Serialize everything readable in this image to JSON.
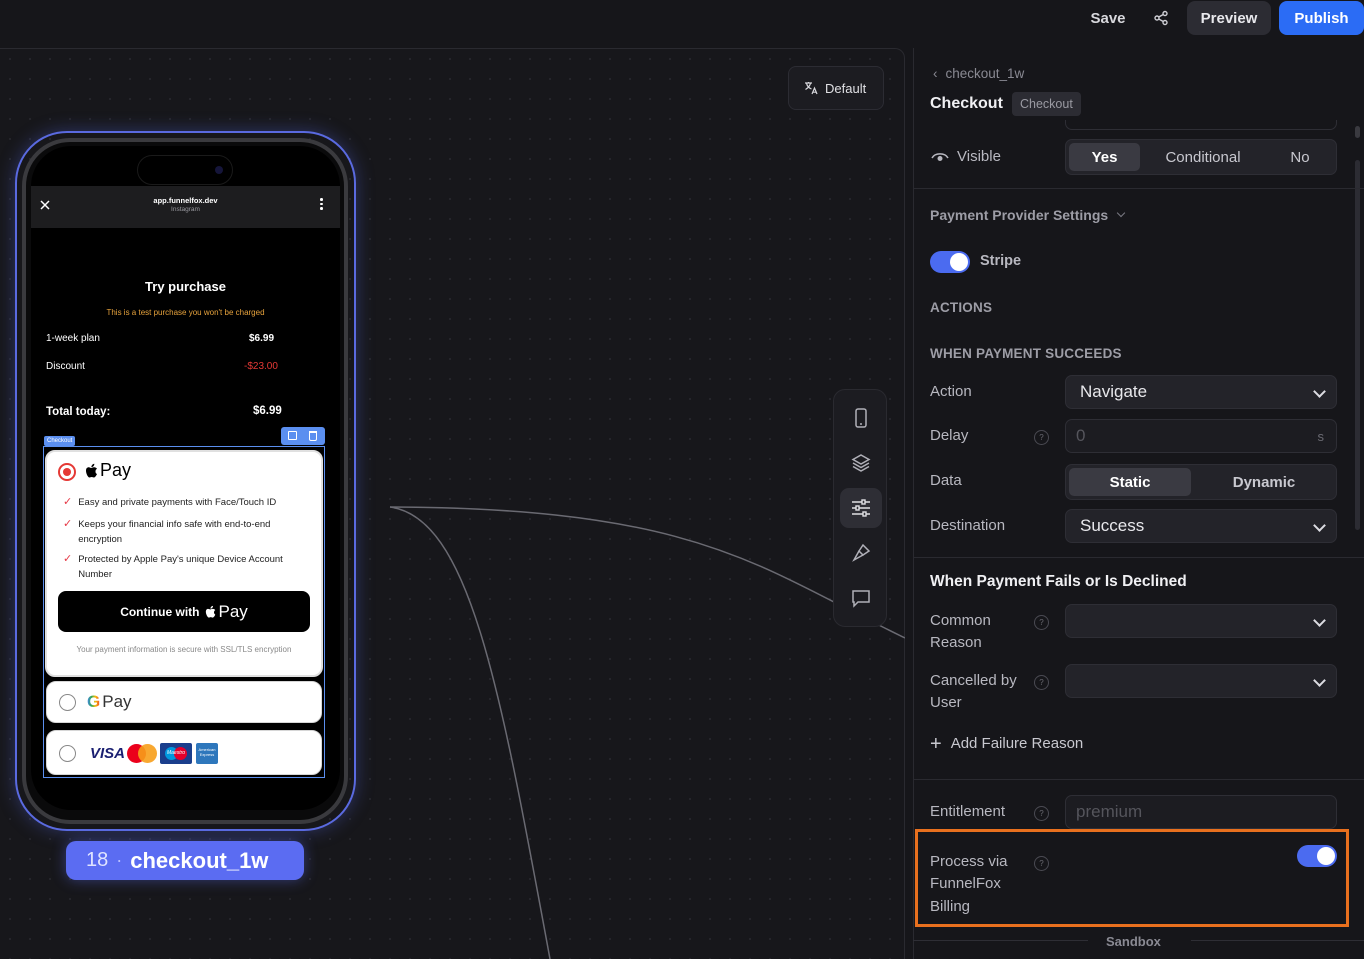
{
  "topbar": {
    "save": "Save",
    "preview": "Preview",
    "publish": "Publish"
  },
  "canvas": {
    "default_chip": "Default"
  },
  "phone": {
    "url": "app.funnelfox.dev",
    "source": "Instagram",
    "title": "Try purchase",
    "test_note": "This is a test purchase you won't be charged",
    "plan_label": "1-week plan",
    "plan_price": "$6.99",
    "discount_label": "Discount",
    "discount_value": "-$23.00",
    "total_label": "Total today:",
    "total_value": "$6.99",
    "element_tag": "Checkout",
    "apple_pay": "Pay",
    "benefits": [
      "Easy and private payments with Face/Touch ID",
      "Keeps your financial info safe with end-to-end encryption",
      "Protected by Apple Pay's unique Device Account Number"
    ],
    "continue_with": "Continue with",
    "secure_note": "Your payment information is secure with SSL/TLS encryption",
    "google_pay": "Pay",
    "visa": "VISA",
    "maestro": "Maestro",
    "amex": "American Express"
  },
  "node": {
    "number": "18",
    "name": "checkout_1w"
  },
  "panel": {
    "breadcrumb": "checkout_1w",
    "title": "Checkout",
    "badge": "Checkout",
    "visible_label": "Visible",
    "visible_options": [
      "Yes",
      "Conditional",
      "No"
    ],
    "provider_settings": "Payment Provider Settings",
    "stripe": "Stripe",
    "actions": "ACTIONS",
    "when_success": "WHEN PAYMENT SUCCEEDS",
    "action_label": "Action",
    "action_value": "Navigate",
    "delay_label": "Delay",
    "delay_placeholder": "0",
    "delay_unit": "s",
    "data_label": "Data",
    "data_options": [
      "Static",
      "Dynamic"
    ],
    "destination_label": "Destination",
    "destination_value": "Success",
    "fails_heading": "When Payment Fails or Is Declined",
    "common_reason_1": "Common",
    "common_reason_2": "Reason",
    "cancelled_1": "Cancelled by",
    "cancelled_2": "User",
    "add_failure": "Add Failure Reason",
    "entitlement_label": "Entitlement",
    "entitlement_placeholder": "premium",
    "process_1": "Process via",
    "process_2": "FunnelFox",
    "process_3": "Billing",
    "sandbox": "Sandbox",
    "accent": "#4b6bf0",
    "highlight": "#e8701e"
  }
}
